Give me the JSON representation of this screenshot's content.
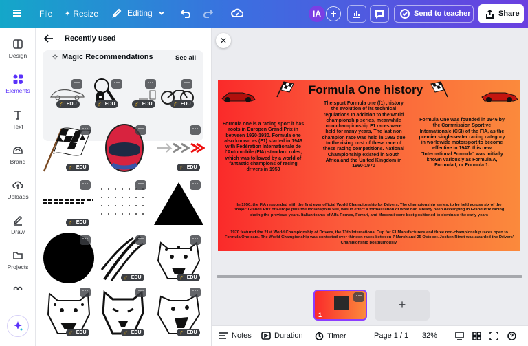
{
  "topbar": {
    "file_label": "File",
    "resize_label": "Resize",
    "editing_label": "Editing",
    "avatar_initials": "IA",
    "send_label": "Send to teacher",
    "share_label": "Share"
  },
  "rail": {
    "items": [
      {
        "label": "Design",
        "icon": "design-icon"
      },
      {
        "label": "Elements",
        "icon": "elements-icon"
      },
      {
        "label": "Text",
        "icon": "text-icon"
      },
      {
        "label": "Brand",
        "icon": "brand-icon"
      },
      {
        "label": "Uploads",
        "icon": "uploads-icon"
      },
      {
        "label": "Draw",
        "icon": "draw-icon"
      },
      {
        "label": "Projects",
        "icon": "projects-icon"
      }
    ]
  },
  "panel": {
    "title": "Recently used",
    "magic_title": "Magic Recommendations",
    "see_all": "See all",
    "edu_badge": "EDU",
    "more_glyph": "···"
  },
  "slide": {
    "title": "Formula One history",
    "left_text": "Formula one is a racing sport  it has roots in Europen Grand Prix in between 1920-1930. Formula one also known as (F1) started in 1946 with Fédération Internationale de l'Automobile (FIA) standard rules, which was followed by a world of fantastic champions of racing drivers in 1950",
    "middle_text": "The sport Formula one (f1) ,history the evolution of its technical regulations In addition to the world championship series, meanwhile non-championship F1 races were held for many years, The last non champion race was held in 1983 due to the rising cost of these race of these racing competitions. National Championship existed in South Africa and the United Kingdom in 1960-1970",
    "right_text": "Formula One was founded in 1946 by the Commission Sportive Internationale (CSI) of the FIA, as the premier single-seater racing category in worldwide motorsport to become effective in 1947.  this new \"International Formula\" was initially known variously as Formula A, Formula I, or Formula 1.",
    "para1": "In 1950, the FIA responded with the first ever official World Championship for Drivers. The championship series, to be held across six of the 'major' Grands Prix of Europe plus the Indianapolis 500, was in effect a formalization of what had already been developing in Grand Prix racing during the previous years. Italian teams of Alfa Romeo, Ferrari, and Maserati were best positioned to dominate the early years",
    "para2": "1970 featured the 21st World Championship of Drivers, the 13th International Cup for F1 Manufacturers and three non-championship races open to Formula One cars. The World Championship was contested over thirteen races between 7 March and 25 October. Jochen Rindt was awarded the Drivers' Championship posthumously."
  },
  "pages": {
    "thumb_number": "1",
    "add_glyph": "+"
  },
  "bottombar": {
    "notes_label": "Notes",
    "duration_label": "Duration",
    "timer_label": "Timer",
    "page_indicator": "Page 1 / 1",
    "zoom": "32%"
  },
  "colors": {
    "accent": "#8b3dff",
    "slide_left": "#fa2a2a",
    "slide_right": "#fb8a3c"
  }
}
